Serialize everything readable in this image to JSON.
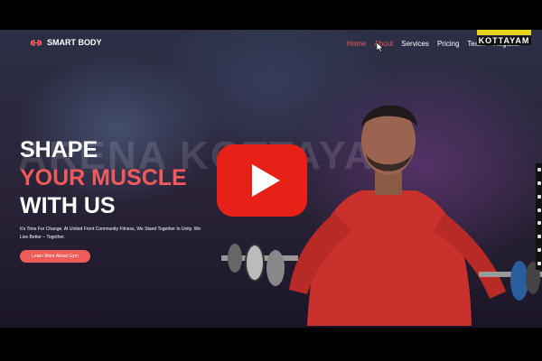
{
  "brand": {
    "name": "SMART BODY"
  },
  "nav": {
    "items": [
      "Home",
      "About",
      "Services",
      "Pricing",
      "Team",
      "Register"
    ],
    "active": "Home"
  },
  "badge": {
    "text": "KOTTAYAM"
  },
  "watermark": {
    "text": "ARENA KOTTAYAM"
  },
  "hero": {
    "line1": "SHAPE",
    "line2": "YOUR MUSCLE",
    "line3": "WITH US",
    "tagline": "It's Time For Change. At United Front Community Fitness, We Stand Together In Unity. We Live Better – Together.",
    "cta": "Learn More About Gym"
  },
  "colors": {
    "accent": "#ee5b5b",
    "play_red": "#e62117",
    "badge_yellow": "#e6d21d"
  },
  "icons": [
    "dumbbell-logo-icon",
    "play-icon",
    "cursor-icon"
  ]
}
